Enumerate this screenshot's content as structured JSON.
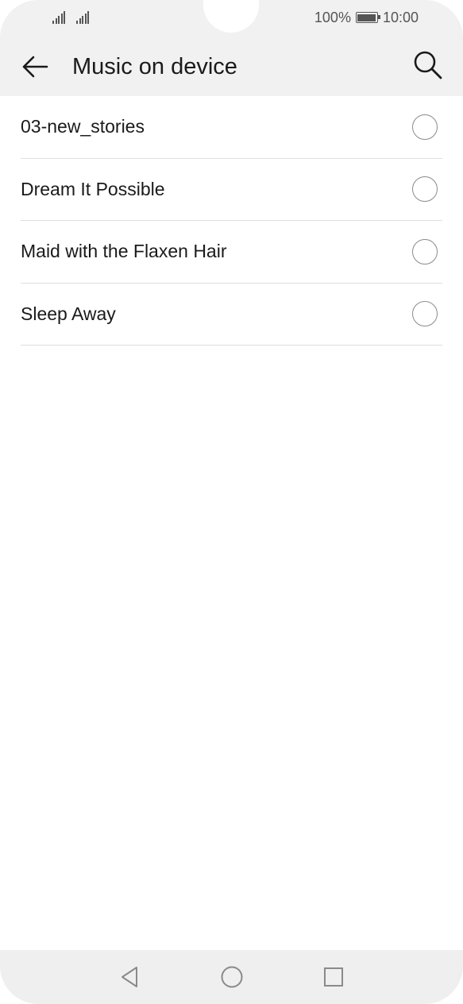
{
  "status_bar": {
    "battery_text": "100%",
    "time": "10:00",
    "signal_icons": [
      "signal-icon",
      "signal-icon"
    ],
    "battery_icon": "battery-icon"
  },
  "app_bar": {
    "title": "Music on device",
    "back_icon": "arrow-left-icon",
    "search_icon": "search-icon"
  },
  "songs": [
    {
      "label": "03-new_stories",
      "selected": false
    },
    {
      "label": "Dream It Possible",
      "selected": false
    },
    {
      "label": "Maid with the Flaxen Hair",
      "selected": false
    },
    {
      "label": "Sleep Away",
      "selected": false
    }
  ],
  "nav_bar": {
    "back_icon": "triangle-back-icon",
    "home_icon": "circle-home-icon",
    "recents_icon": "square-recents-icon"
  },
  "colors": {
    "header_bg": "#f1f1f1",
    "divider": "#dedede",
    "text": "#1a1a1a",
    "nav_bg": "#efefef"
  }
}
